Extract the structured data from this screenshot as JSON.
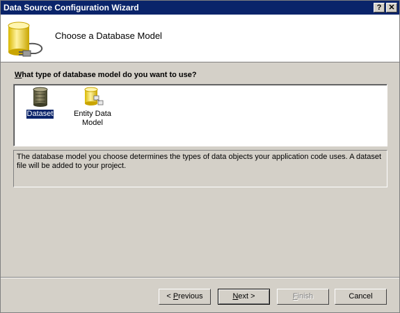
{
  "window": {
    "title": "Data Source Configuration Wizard",
    "help_glyph": "?",
    "close_glyph": "✕"
  },
  "header": {
    "title": "Choose a Database Model",
    "icon": "database-plug-icon"
  },
  "question": {
    "accel": "W",
    "rest": "hat type of database model do you want to use?"
  },
  "models": [
    {
      "label": "Dataset",
      "icon": "dataset-icon",
      "selected": true
    },
    {
      "label_line1": "Entity Data",
      "label_line2": "Model",
      "icon": "entity-data-model-icon",
      "selected": false
    }
  ],
  "description": "The database model you choose determines the types of data objects your application code uses. A dataset file will be added to your project.",
  "buttons": {
    "previous": {
      "prefix": "< ",
      "accel": "P",
      "rest": "revious"
    },
    "next": {
      "accel": "N",
      "rest": "ext >"
    },
    "finish": {
      "accel": "F",
      "rest": "inish",
      "enabled": false
    },
    "cancel": {
      "label": "Cancel"
    }
  },
  "colors": {
    "title_bar": "#0a246a",
    "face": "#d4d0c8",
    "selection": "#0a246a",
    "db_yellow": "#f5e05a"
  }
}
